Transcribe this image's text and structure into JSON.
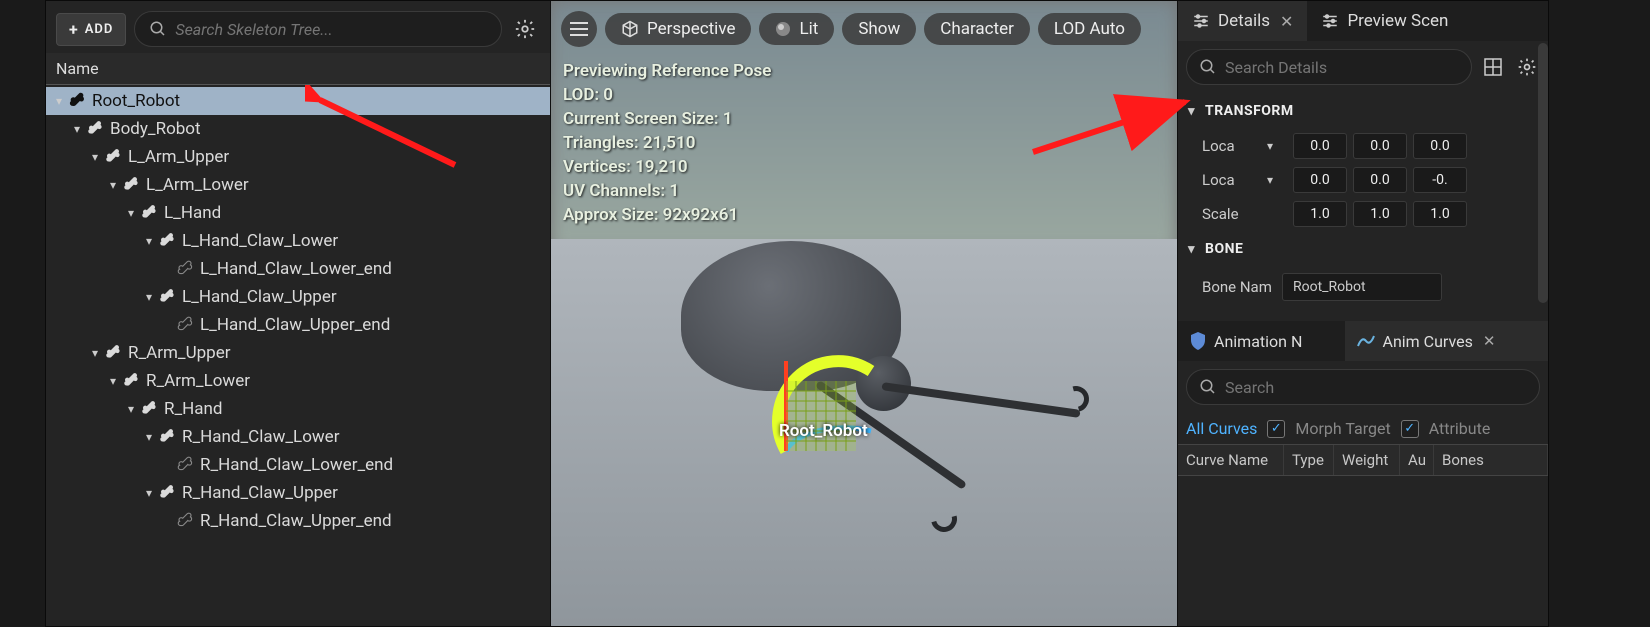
{
  "left": {
    "add_label": "ADD",
    "search_placeholder": "Search Skeleton Tree...",
    "column_header": "Name",
    "tree": [
      {
        "name": "Root_Robot",
        "depth": 0,
        "expanded": true,
        "end": false,
        "selected": true
      },
      {
        "name": "Body_Robot",
        "depth": 1,
        "expanded": true,
        "end": false
      },
      {
        "name": "L_Arm_Upper",
        "depth": 2,
        "expanded": true,
        "end": false
      },
      {
        "name": "L_Arm_Lower",
        "depth": 3,
        "expanded": true,
        "end": false
      },
      {
        "name": "L_Hand",
        "depth": 4,
        "expanded": true,
        "end": false
      },
      {
        "name": "L_Hand_Claw_Lower",
        "depth": 5,
        "expanded": true,
        "end": false
      },
      {
        "name": "L_Hand_Claw_Lower_end",
        "depth": 6,
        "expanded": false,
        "end": true
      },
      {
        "name": "L_Hand_Claw_Upper",
        "depth": 5,
        "expanded": true,
        "end": false
      },
      {
        "name": "L_Hand_Claw_Upper_end",
        "depth": 6,
        "expanded": false,
        "end": true
      },
      {
        "name": "R_Arm_Upper",
        "depth": 2,
        "expanded": true,
        "end": false
      },
      {
        "name": "R_Arm_Lower",
        "depth": 3,
        "expanded": true,
        "end": false
      },
      {
        "name": "R_Hand",
        "depth": 4,
        "expanded": true,
        "end": false
      },
      {
        "name": "R_Hand_Claw_Lower",
        "depth": 5,
        "expanded": true,
        "end": false
      },
      {
        "name": "R_Hand_Claw_Lower_end",
        "depth": 6,
        "expanded": false,
        "end": true
      },
      {
        "name": "R_Hand_Claw_Upper",
        "depth": 5,
        "expanded": true,
        "end": false
      },
      {
        "name": "R_Hand_Claw_Upper_end",
        "depth": 6,
        "expanded": false,
        "end": true
      }
    ]
  },
  "viewport": {
    "pills": {
      "perspective": "Perspective",
      "lit": "Lit",
      "show": "Show",
      "character": "Character",
      "lod": "LOD Auto"
    },
    "stats": {
      "l1": "Previewing Reference Pose",
      "l2": "LOD: 0",
      "l3": "Current Screen Size: 1",
      "l4": "Triangles: 21,510",
      "l5": "Vertices: 19,210",
      "l6": "UV Channels: 1",
      "l7": "Approx Size: 92x92x61"
    },
    "bone_label": "Root_Robot"
  },
  "right": {
    "tabs": {
      "details": "Details",
      "preview": "Preview Scen"
    },
    "search_placeholder": "Search Details",
    "transform_header": "TRANSFORM",
    "location_label": "Loca",
    "rotation_label": "Loca",
    "scale_label": "Scale",
    "loc": [
      "0.0",
      "0.0",
      "0.0"
    ],
    "rot": [
      "0.0",
      "0.0",
      "-0."
    ],
    "scale": [
      "1.0",
      "1.0",
      "1.0"
    ],
    "bone_header": "BONE",
    "bone_name_label": "Bone Nam",
    "bone_name_value": "Root_Robot",
    "curves_tabs": {
      "anim_n": "Animation N",
      "anim_curves": "Anim Curves"
    },
    "curves_search_placeholder": "Search",
    "filters": {
      "all": "All Curves",
      "morph": "Morph Target",
      "attr": "Attribute"
    },
    "table_cols": {
      "name": "Curve Name",
      "type": "Type",
      "weight": "Weight",
      "auto": "Au",
      "bones": "Bones"
    }
  }
}
